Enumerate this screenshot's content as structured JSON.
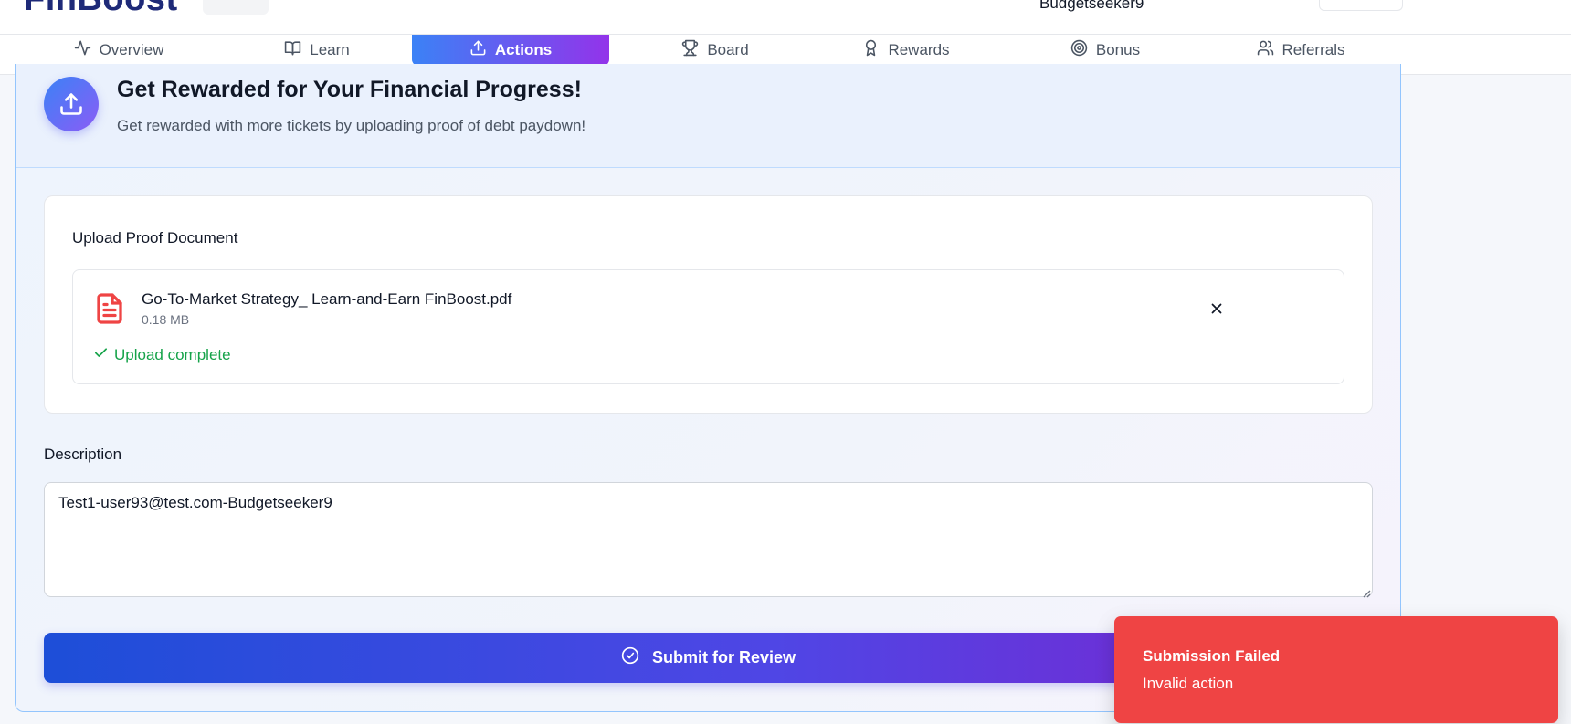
{
  "header": {
    "logo_text": "FinBoost",
    "username": "Budgetseeker9"
  },
  "nav": {
    "tabs": [
      {
        "label": "Overview",
        "icon": "activity-icon",
        "active": false
      },
      {
        "label": "Learn",
        "icon": "book-open-icon",
        "active": false
      },
      {
        "label": "Actions",
        "icon": "upload-icon",
        "active": true
      },
      {
        "label": "Board",
        "icon": "trophy-icon",
        "active": false
      },
      {
        "label": "Rewards",
        "icon": "award-icon",
        "active": false
      },
      {
        "label": "Bonus",
        "icon": "target-icon",
        "active": false
      },
      {
        "label": "Referrals",
        "icon": "users-icon",
        "active": false
      }
    ]
  },
  "card": {
    "icon": "upload-icon",
    "title": "Get Rewarded for Your Financial Progress!",
    "subtitle": "Get rewarded with more tickets by uploading proof of debt paydown!"
  },
  "upload": {
    "label": "Upload Proof Document",
    "file_name": "Go-To-Market Strategy_ Learn-and-Earn FinBoost.pdf",
    "file_size": "0.18 MB",
    "file_icon": "file-text-icon",
    "status": "Upload complete",
    "status_color": "#16a34a"
  },
  "description": {
    "label": "Description",
    "value": "Test1-user93@test.com-Budgetseeker9"
  },
  "submit": {
    "label": "Submit for Review",
    "icon": "check-circle-icon"
  },
  "toast": {
    "title": "Submission Failed",
    "message": "Invalid action",
    "color": "#ef4444"
  },
  "colors": {
    "accent_start": "#3b82f6",
    "accent_end": "#9333ea",
    "error": "#ef4444",
    "success": "#16a34a"
  }
}
